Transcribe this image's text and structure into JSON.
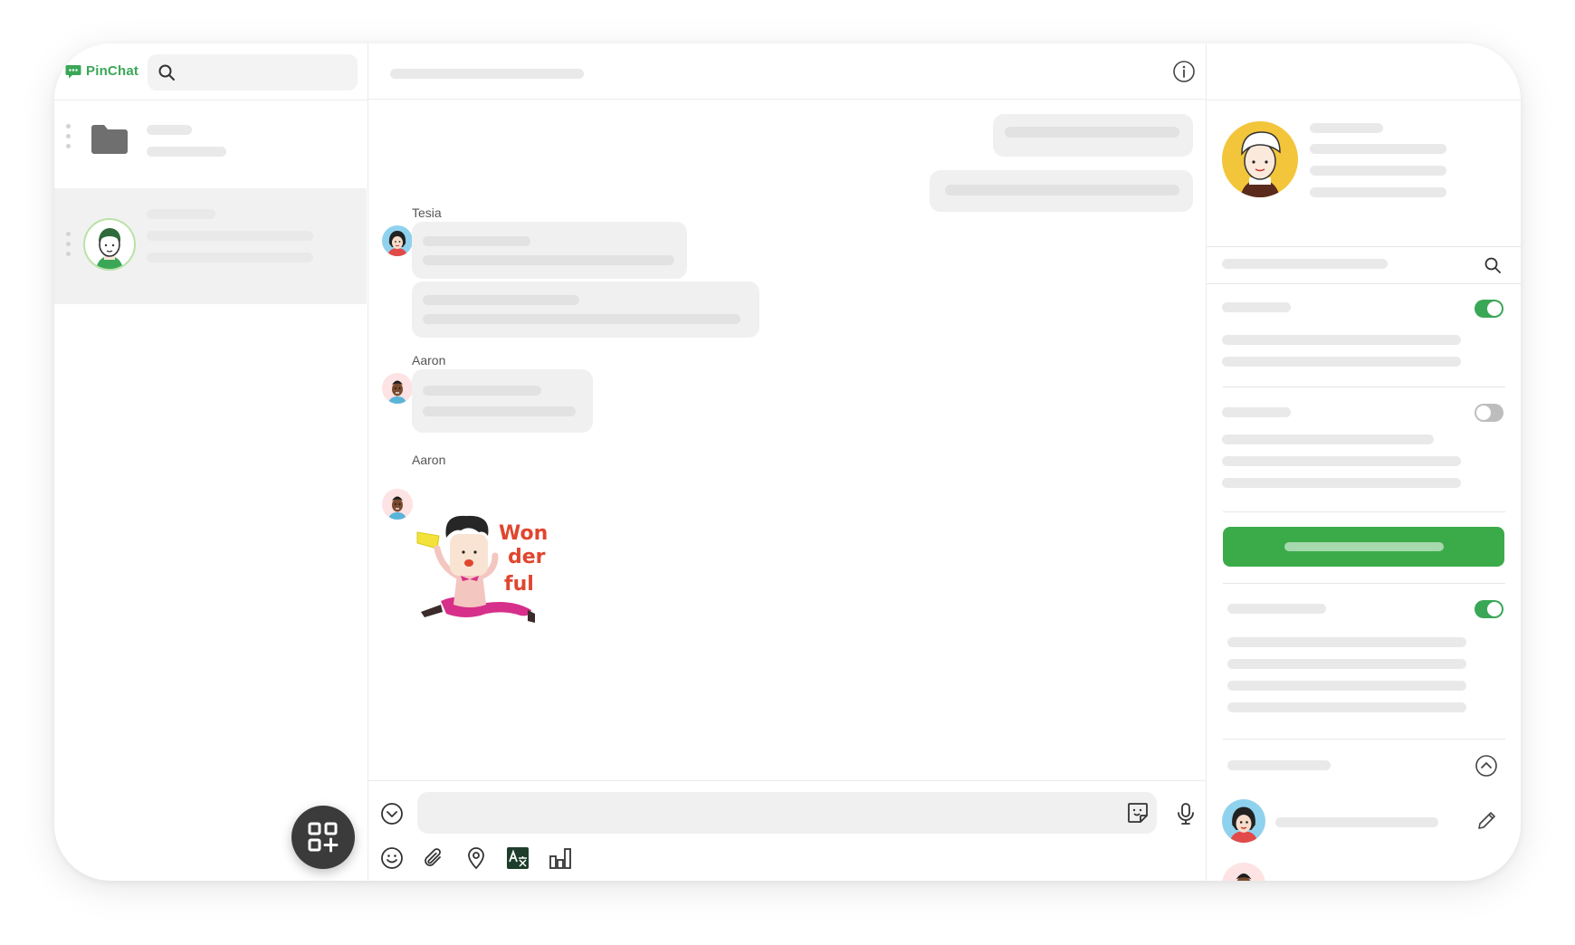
{
  "app": {
    "name": "PinChat"
  },
  "sidebar": {
    "search_placeholder": "",
    "chats": [
      {
        "type": "folder",
        "icon": "folder-icon"
      },
      {
        "type": "contact",
        "icon": "avatar",
        "active": true
      }
    ],
    "fab_icon": "add-app-grid-icon"
  },
  "chat": {
    "header_icon": "info-icon",
    "messages": [
      {
        "from": "me"
      },
      {
        "from": "me"
      },
      {
        "from": "Tesia"
      },
      {
        "from": "Aaron"
      },
      {
        "from": "Aaron",
        "sticker_text": [
          "Won",
          "der",
          "ful"
        ]
      }
    ],
    "senders": {
      "tesia": "Tesia",
      "aaron_1": "Aaron",
      "aaron_2": "Aaron"
    },
    "composer": {
      "placeholder": "",
      "tools": [
        "expand-icon",
        "emoji-icon",
        "attachment-icon",
        "location-icon",
        "translate-icon",
        "poll-icon",
        "sticker-icon",
        "microphone-icon"
      ]
    }
  },
  "info_panel": {
    "toggles": [
      {
        "state": "on"
      },
      {
        "state": "off"
      },
      {
        "state": "on"
      }
    ],
    "collapse_icon": "chevron-up-icon",
    "edit_icon": "pencil-icon"
  },
  "colors": {
    "brand": "#3aa757",
    "button_green": "#3bab4a",
    "fab": "#3b3b3b",
    "placeholder": "#e9e9e9"
  }
}
